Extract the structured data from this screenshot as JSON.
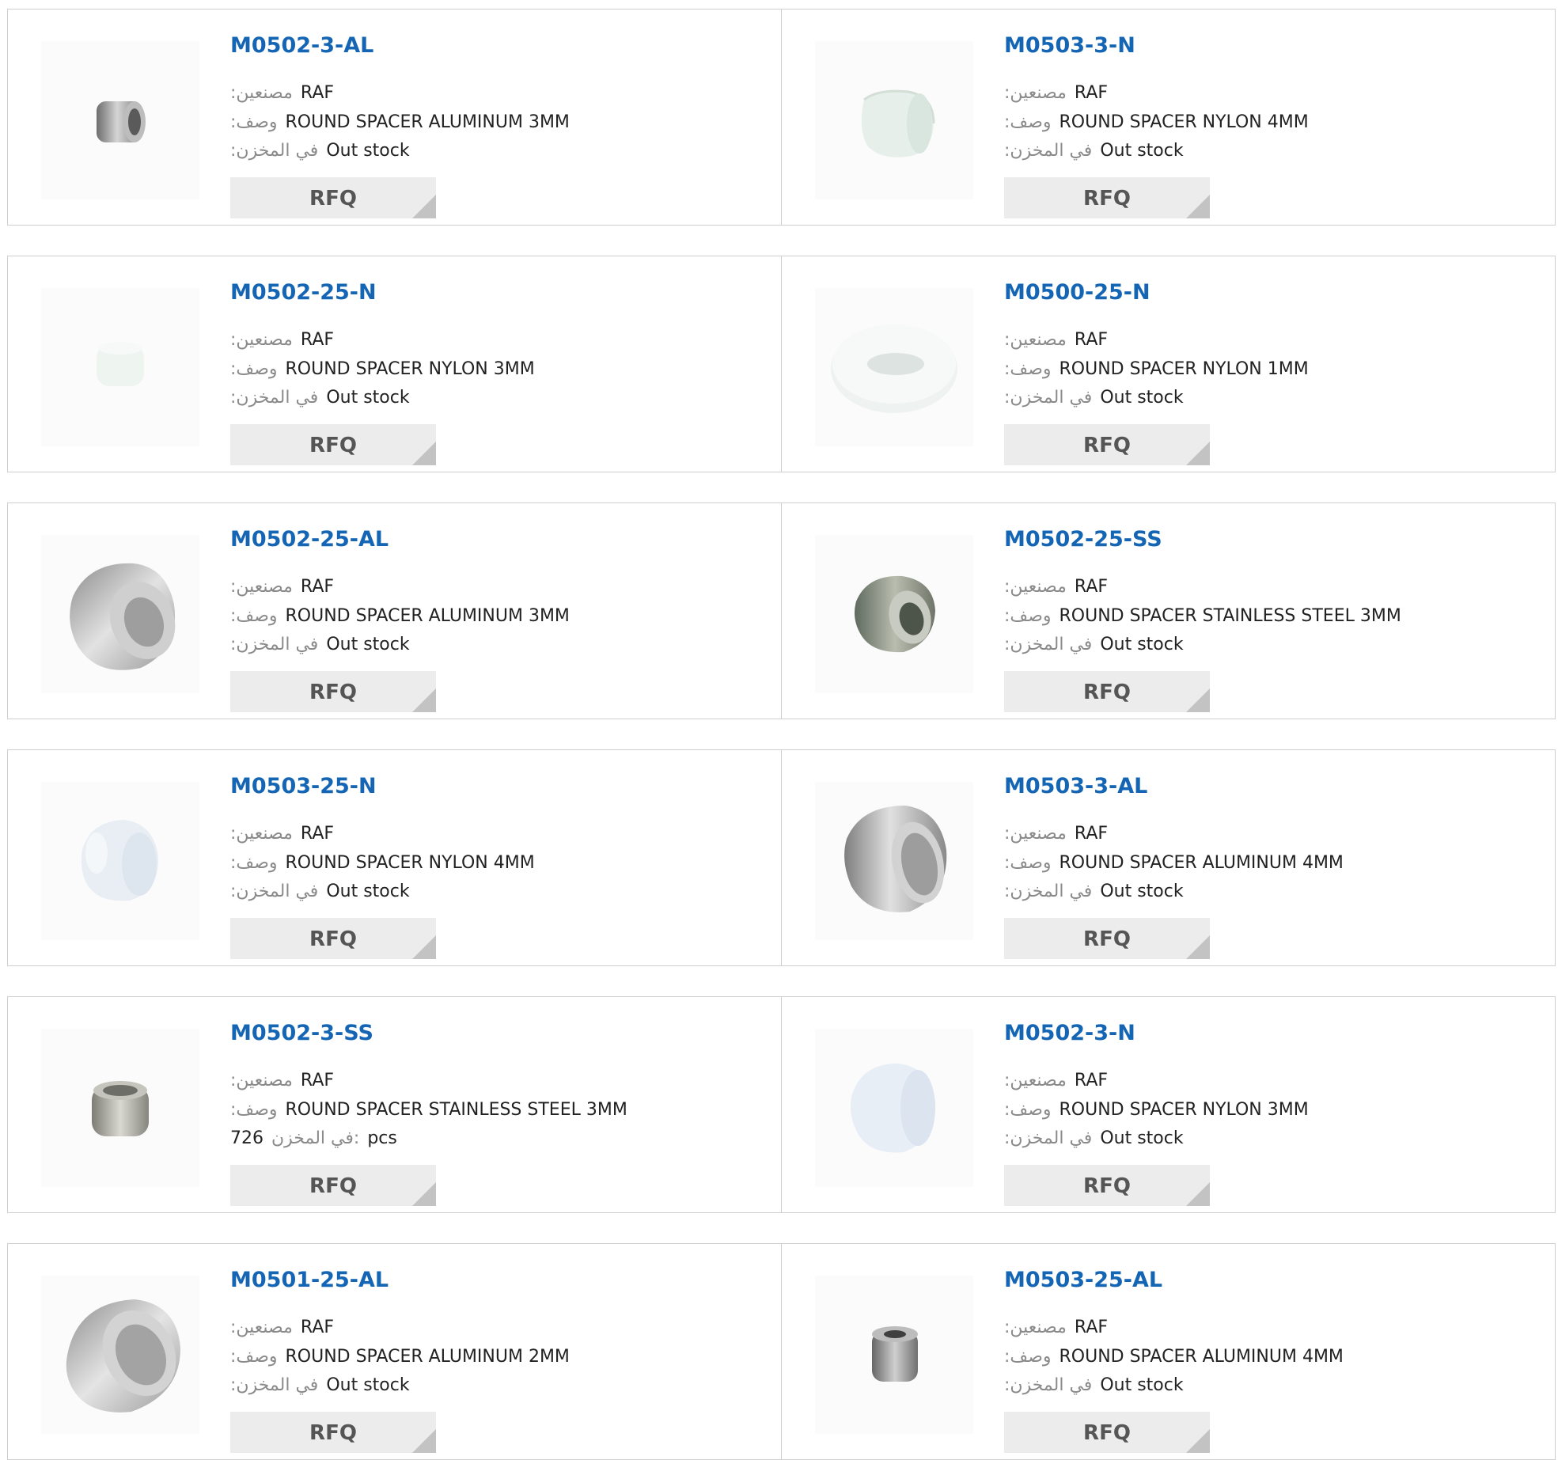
{
  "labels": {
    "manufacturer": ":مصنعين",
    "description": ":وصف",
    "stock": ":في المخزن",
    "stock_qty": "في المخزن:",
    "button": "RFQ"
  },
  "products": [
    {
      "pn": "M0502-3-AL",
      "mfr": "RAF",
      "desc": "ROUND SPACER ALUMINUM 3MM",
      "stock": "Out stock"
    },
    {
      "pn": "M0503-3-N",
      "mfr": "RAF",
      "desc": "ROUND SPACER NYLON 4MM",
      "stock": "Out stock"
    },
    {
      "pn": "M0502-25-N",
      "mfr": "RAF",
      "desc": "ROUND SPACER NYLON 3MM",
      "stock": "Out stock"
    },
    {
      "pn": "M0500-25-N",
      "mfr": "RAF",
      "desc": "ROUND SPACER NYLON 1MM",
      "stock": "Out stock"
    },
    {
      "pn": "M0502-25-AL",
      "mfr": "RAF",
      "desc": "ROUND SPACER ALUMINUM 3MM",
      "stock": "Out stock"
    },
    {
      "pn": "M0502-25-SS",
      "mfr": "RAF",
      "desc": "ROUND SPACER STAINLESS STEEL 3MM",
      "stock": "Out stock"
    },
    {
      "pn": "M0503-25-N",
      "mfr": "RAF",
      "desc": "ROUND SPACER NYLON 4MM",
      "stock": "Out stock"
    },
    {
      "pn": "M0503-3-AL",
      "mfr": "RAF",
      "desc": "ROUND SPACER ALUMINUM 4MM",
      "stock": "Out stock"
    },
    {
      "pn": "M0502-3-SS",
      "mfr": "RAF",
      "desc": "ROUND SPACER STAINLESS STEEL 3MM",
      "stock_qty": "726",
      "stock_unit": "pcs"
    },
    {
      "pn": "M0502-3-N",
      "mfr": "RAF",
      "desc": "ROUND SPACER NYLON 3MM",
      "stock": "Out stock"
    },
    {
      "pn": "M0501-25-AL",
      "mfr": "RAF",
      "desc": "ROUND SPACER ALUMINUM 2MM",
      "stock": "Out stock"
    },
    {
      "pn": "M0503-25-AL",
      "mfr": "RAF",
      "desc": "ROUND SPACER ALUMINUM 4MM",
      "stock": "Out stock"
    }
  ],
  "colors": {
    "link": "#1565b5",
    "label": "#8a8a8a",
    "border": "#cfcfcf",
    "button_bg": "#ececec"
  }
}
